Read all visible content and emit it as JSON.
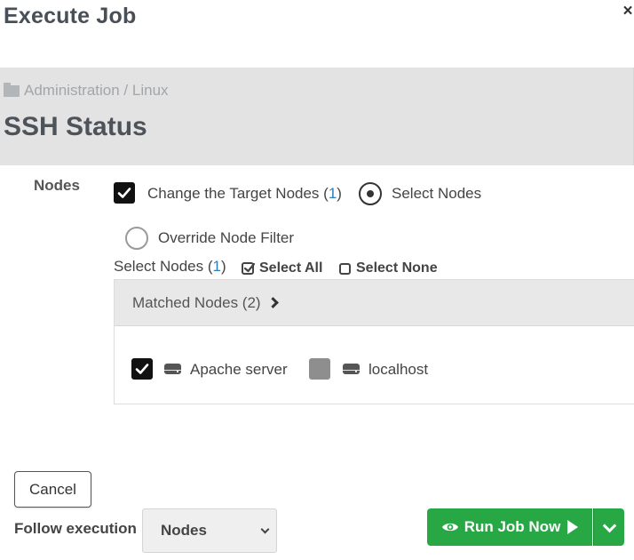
{
  "modal": {
    "title": "Execute Job",
    "close_symbol": "×"
  },
  "job": {
    "breadcrumb": "Administration / Linux",
    "name": "SSH Status"
  },
  "nodes_section": {
    "label": "Nodes",
    "change_target": {
      "label_prefix": "Change the Target Nodes (",
      "count": "1",
      "label_suffix": ")",
      "checked": true
    },
    "select_nodes_radio": {
      "label": "Select Nodes",
      "selected": true
    },
    "override_filter_radio": {
      "label": "Override Node Filter",
      "selected": false
    },
    "select_nodes_summary": {
      "prefix": "Select Nodes (",
      "count": "1",
      "suffix": ")"
    },
    "select_all_label": "Select All",
    "select_none_label": "Select None",
    "matched_nodes": {
      "header": "Matched Nodes (2)",
      "items": [
        {
          "name": "Apache server",
          "checked": true
        },
        {
          "name": "localhost",
          "checked": false
        }
      ]
    }
  },
  "footer": {
    "cancel_label": "Cancel",
    "follow_label": "Follow execution",
    "follow_selected": "Nodes",
    "run_label": "Run Job Now"
  },
  "colors": {
    "primary_green": "#28a745",
    "link_blue": "#2c7fb8",
    "header_gray": "#e3e3e3"
  },
  "icons": [
    "close-icon",
    "folder-icon",
    "check-icon",
    "chevron-right-icon",
    "server-icon",
    "eye-icon",
    "play-icon",
    "chevron-down-icon"
  ]
}
